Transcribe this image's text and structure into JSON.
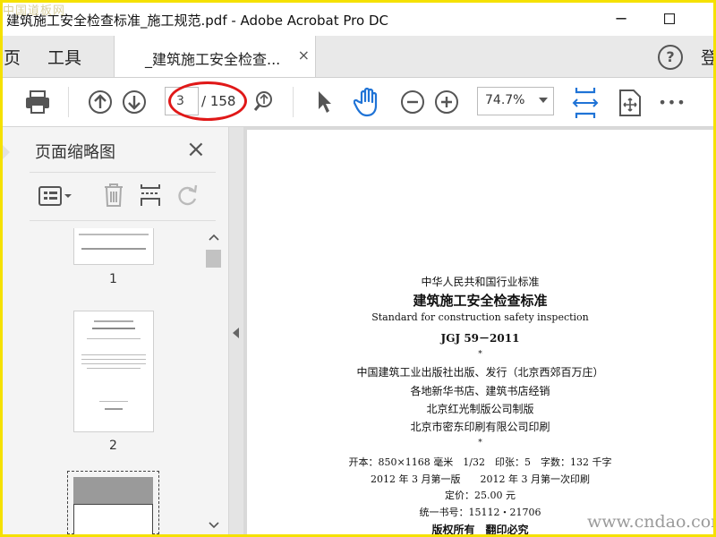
{
  "watermark_top": "中国道板网",
  "window": {
    "title": "建筑施工安全检查标准_施工规范.pdf - Adobe Acrobat Pro DC",
    "minimize": "─",
    "maximize": "☐"
  },
  "menu": {
    "home_frag": "页",
    "tools": "工具",
    "help": "?",
    "login_frag": "登"
  },
  "tab": {
    "label": "_建筑施工安全检查...",
    "close": "×"
  },
  "toolbar": {
    "page_current": "3",
    "page_total": "/ 158",
    "zoom": "74.7%",
    "more": "•••"
  },
  "panel": {
    "title": "页面缩略图",
    "close": "×",
    "thumbnails": [
      {
        "num": "1"
      },
      {
        "num": "2"
      }
    ]
  },
  "document": {
    "lines": [
      "中华人民共和国行业标准",
      "建筑施工安全检查标准",
      "Standard for construction safety inspection",
      "JGJ 59－2011",
      "*",
      "中国建筑工业出版社出版、发行（北京西郊百万庄）",
      "各地新华书店、建筑书店经销",
      "北京红光制版公司制版",
      "北京市密东印刷有限公司印刷",
      "*",
      "开本：850×1168 毫米　1/32　印张：5　字数：132 千字",
      "2012 年 3 月第一版　　2012 年 3 月第一次印刷",
      "定价：25.00 元",
      "统一书号：15112・21706",
      "版权所有　翻印必究"
    ]
  },
  "watermark_bottom": "www.cndao.com"
}
